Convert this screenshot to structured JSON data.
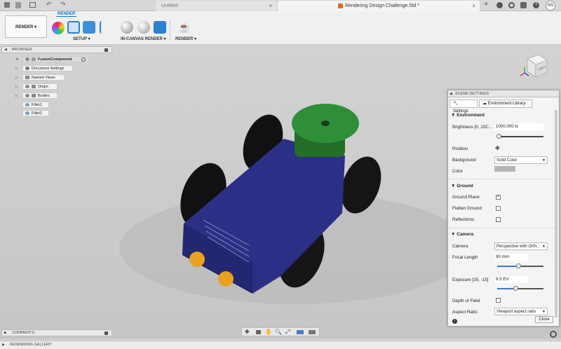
{
  "titlebar": {
    "tabs": [
      {
        "label": "Untitled",
        "active": false
      },
      {
        "label": "Rendering Design Challenge.f3d *",
        "active": true
      }
    ],
    "user_initials": "NS"
  },
  "toolbar": {
    "workspace": "RENDER",
    "active_tab": "RENDER",
    "groups": [
      {
        "label": "SETUP ▾"
      },
      {
        "label": "IN-CANVAS RENDER ▾"
      },
      {
        "label": "RENDER ▾"
      }
    ]
  },
  "browser": {
    "title": "BROWSER",
    "items": [
      {
        "label": "FusionComponent"
      },
      {
        "label": "Document Settings"
      },
      {
        "label": "Named Views"
      },
      {
        "label": "Origin"
      },
      {
        "label": "Bodies"
      },
      {
        "label": "Fillet1"
      },
      {
        "label": "Fillet2"
      }
    ]
  },
  "viewcube": {
    "face": "LEFT"
  },
  "scene_settings": {
    "title": "SCENE SETTINGS",
    "tabs": [
      {
        "label": "Settings"
      },
      {
        "label": "Environment Library"
      }
    ],
    "environment": {
      "heading": "Environment",
      "brightness_label": "Brightness [0, 10C...",
      "brightness_value": "1000.000 lx",
      "position_label": "Position",
      "background_label": "Background",
      "background_value": "Solid Color",
      "color_label": "Color",
      "color_swatch": "#b4b4b4"
    },
    "ground": {
      "heading": "Ground",
      "ground_plane_label": "Ground Plane",
      "ground_plane_checked": true,
      "flatten_label": "Flatten Ground",
      "flatten_checked": false,
      "reflections_label": "Reflections",
      "reflections_checked": false
    },
    "camera": {
      "heading": "Camera",
      "camera_label": "Camera",
      "camera_value": "Perspective with Orth...",
      "focal_label": "Focal Length",
      "focal_value": "90 mm",
      "focal_level": 0.45,
      "exposure_label": "Exposure [25, -15]",
      "exposure_value": "9.5 EV",
      "exposure_level": 0.4,
      "dof_label": "Depth of Field",
      "dof_checked": false,
      "aspect_label": "Aspect Ratio",
      "aspect_value": "Viewport aspect ratio"
    },
    "close_label": "Close"
  },
  "comments": {
    "title": "COMMENTS"
  },
  "gallery": {
    "title": "RENDERING GALLERY"
  },
  "colors": {
    "car_body": "#2b2f86",
    "car_top": "#2f8f36",
    "headlight": "#e8a21e",
    "accent": "#0078d7"
  }
}
